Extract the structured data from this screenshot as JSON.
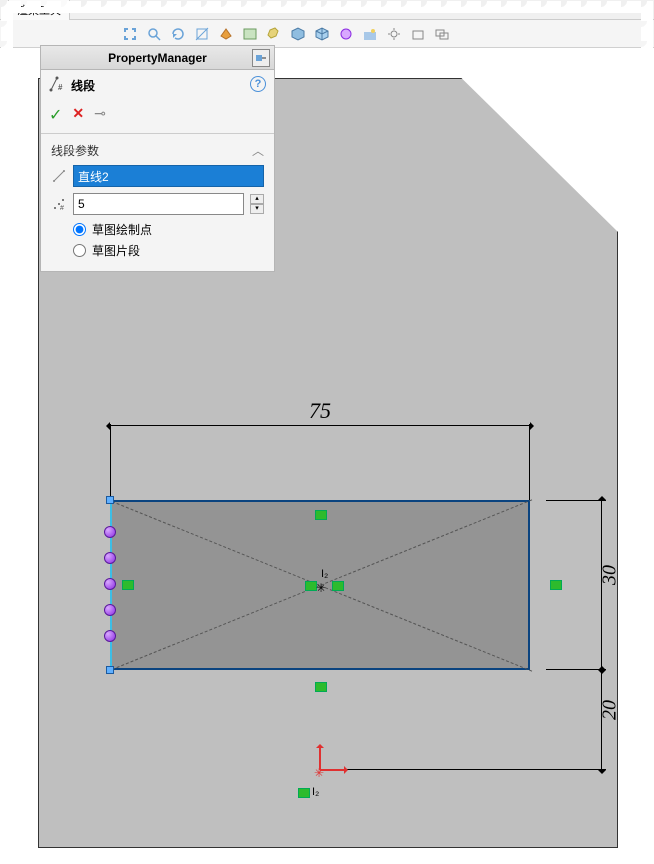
{
  "tabs": {
    "render": "渲染工具"
  },
  "pm": {
    "header": "PropertyManager",
    "title": "线段",
    "ok_glyph": "✓",
    "cancel_glyph": "✕",
    "pin_glyph": "⟟",
    "help_glyph": "?",
    "section": "线段参数",
    "entity_value": "直线2",
    "count_value": "5",
    "radio1": "草图绘制点",
    "radio2": "草图片段"
  },
  "dims": {
    "w": "75",
    "h": "30",
    "off": "20"
  },
  "marks": {
    "center": "I₂",
    "origin": "I₂"
  }
}
